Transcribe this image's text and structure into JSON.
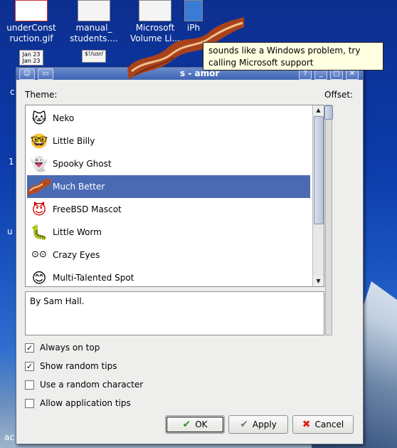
{
  "desktop": {
    "icons": [
      {
        "label": "underConst\nruction.gif"
      },
      {
        "label": "manual_\nstudents...."
      },
      {
        "label": "Microsoft\nVolume Li..."
      },
      {
        "label": "iPh"
      }
    ],
    "small_icons": [
      {
        "label": "Jan 23\nJan 23"
      },
      {
        "label": "$!/usr/"
      }
    ],
    "edge_letters": [
      "c",
      "1",
      "u",
      "ac"
    ]
  },
  "window": {
    "title_partial": "s - amor",
    "theme_label": "Theme:",
    "offset_label": "Offset:",
    "themes": [
      {
        "name": "Neko",
        "icon": "cat-icon"
      },
      {
        "name": "Little Billy",
        "icon": "billy-icon"
      },
      {
        "name": "Spooky Ghost",
        "icon": "ghost-icon"
      },
      {
        "name": "Much Better",
        "icon": "bacon-icon",
        "selected": true
      },
      {
        "name": "FreeBSD Mascot",
        "icon": "daemon-icon"
      },
      {
        "name": "Little Worm",
        "icon": "worm-icon"
      },
      {
        "name": "Crazy Eyes",
        "icon": "eyes-icon"
      },
      {
        "name": "Multi-Talented Spot",
        "icon": "smiley-icon"
      }
    ],
    "description": "By Sam Hall.",
    "options": [
      {
        "label": "Always on top",
        "checked": true
      },
      {
        "label": "Show random tips",
        "checked": true
      },
      {
        "label": "Use a random character",
        "checked": false
      },
      {
        "label": "Allow application tips",
        "checked": false
      }
    ],
    "buttons": {
      "ok": "OK",
      "apply": "Apply",
      "cancel": "Cancel"
    }
  },
  "tooltip": {
    "line1": "sounds like a Windows problem, try",
    "line2": "calling Microsoft support"
  },
  "colors": {
    "selection": "#4a6bb4",
    "titlebar": "#3d63b3",
    "tooltip_bg": "#ffffe1"
  }
}
